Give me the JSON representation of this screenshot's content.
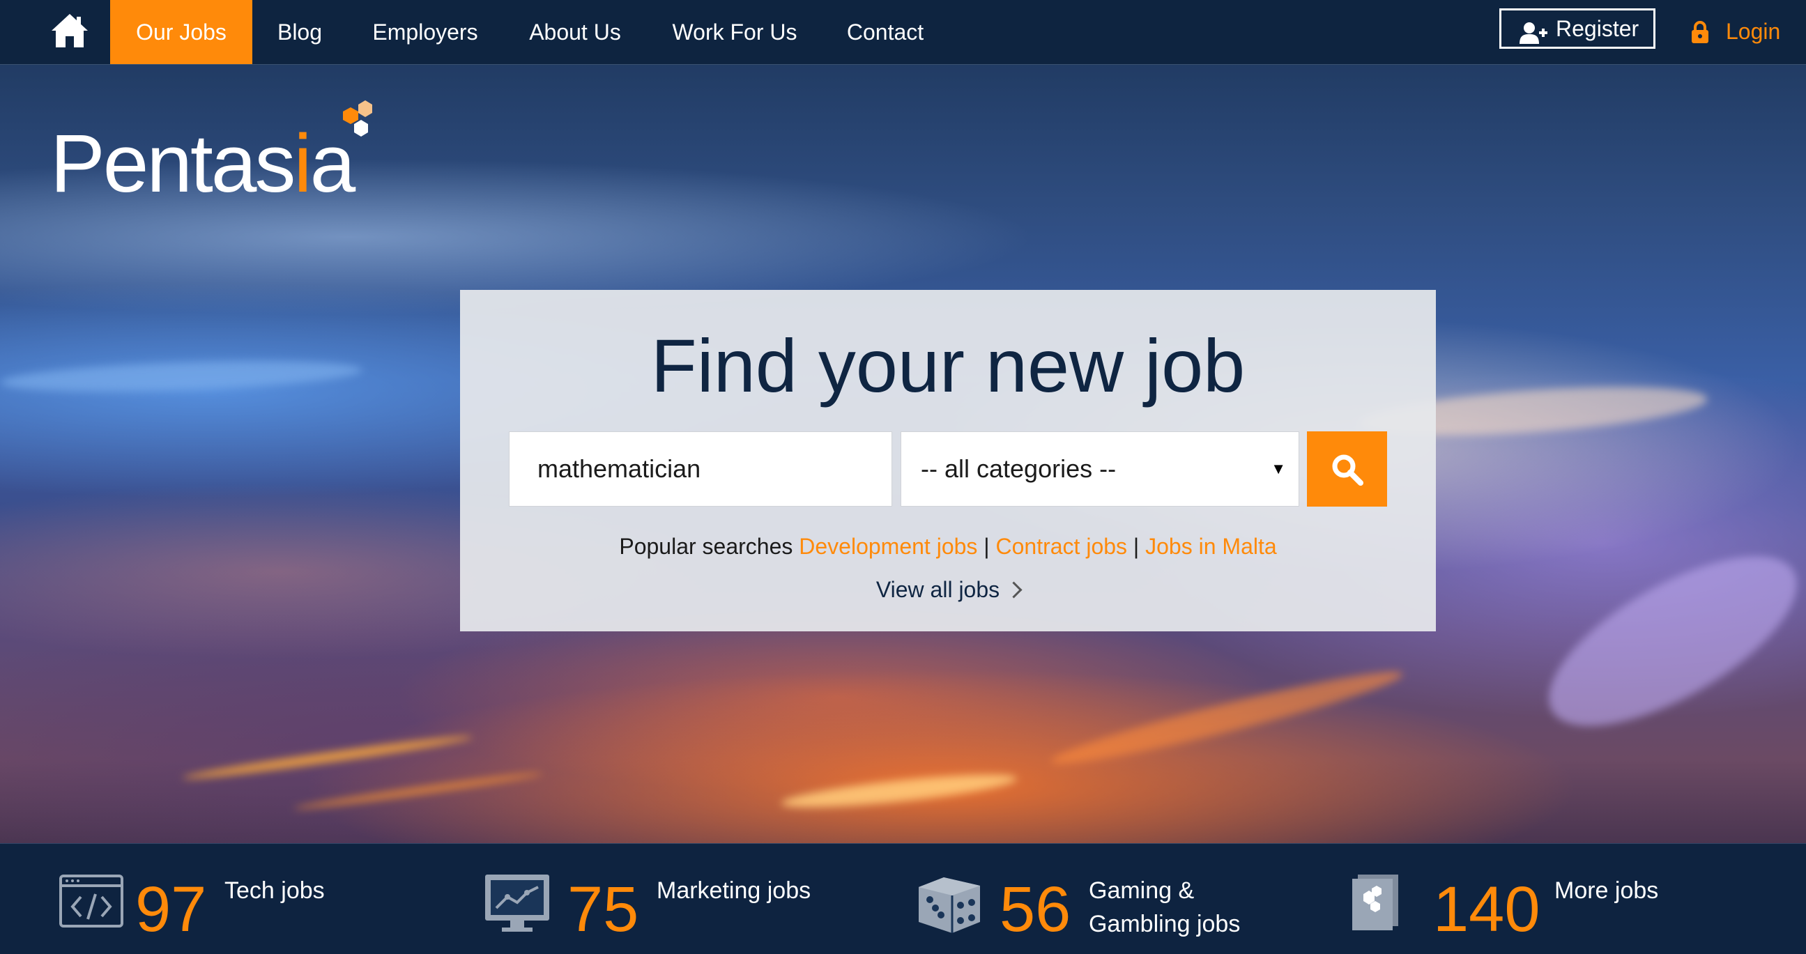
{
  "nav": {
    "items": [
      {
        "label": "Our Jobs",
        "active": true
      },
      {
        "label": "Blog",
        "active": false
      },
      {
        "label": "Employers",
        "active": false
      },
      {
        "label": "About Us",
        "active": false
      },
      {
        "label": "Work For Us",
        "active": false
      },
      {
        "label": "Contact",
        "active": false
      }
    ],
    "register_label": "Register",
    "login_label": "Login",
    "icons": {
      "home": "home-icon",
      "register": "add-user-icon",
      "login": "lock-icon"
    }
  },
  "brand": {
    "name_main": "Pentas",
    "name_accent": "i",
    "name_end": "a",
    "accent_color": "#ff8a0a",
    "navy_color": "#0e2440"
  },
  "search": {
    "headline": "Find your new job",
    "keyword_value": "mathematician",
    "category_selected": "-- all categories --",
    "popular_prefix": "Popular searches",
    "popular_links": [
      "Development jobs",
      "Contract jobs",
      "Jobs in Malta"
    ],
    "separator": "|",
    "view_all_label": "View all jobs"
  },
  "stats": [
    {
      "count": "97",
      "label": "Tech jobs",
      "icon": "code-window-icon"
    },
    {
      "count": "75",
      "label": "Marketing jobs",
      "icon": "monitor-chart-icon"
    },
    {
      "count": "56",
      "label": "Gaming & Gambling jobs",
      "icon": "dice-icon"
    },
    {
      "count": "140",
      "label": "More jobs",
      "icon": "hexagon-docs-icon"
    }
  ]
}
